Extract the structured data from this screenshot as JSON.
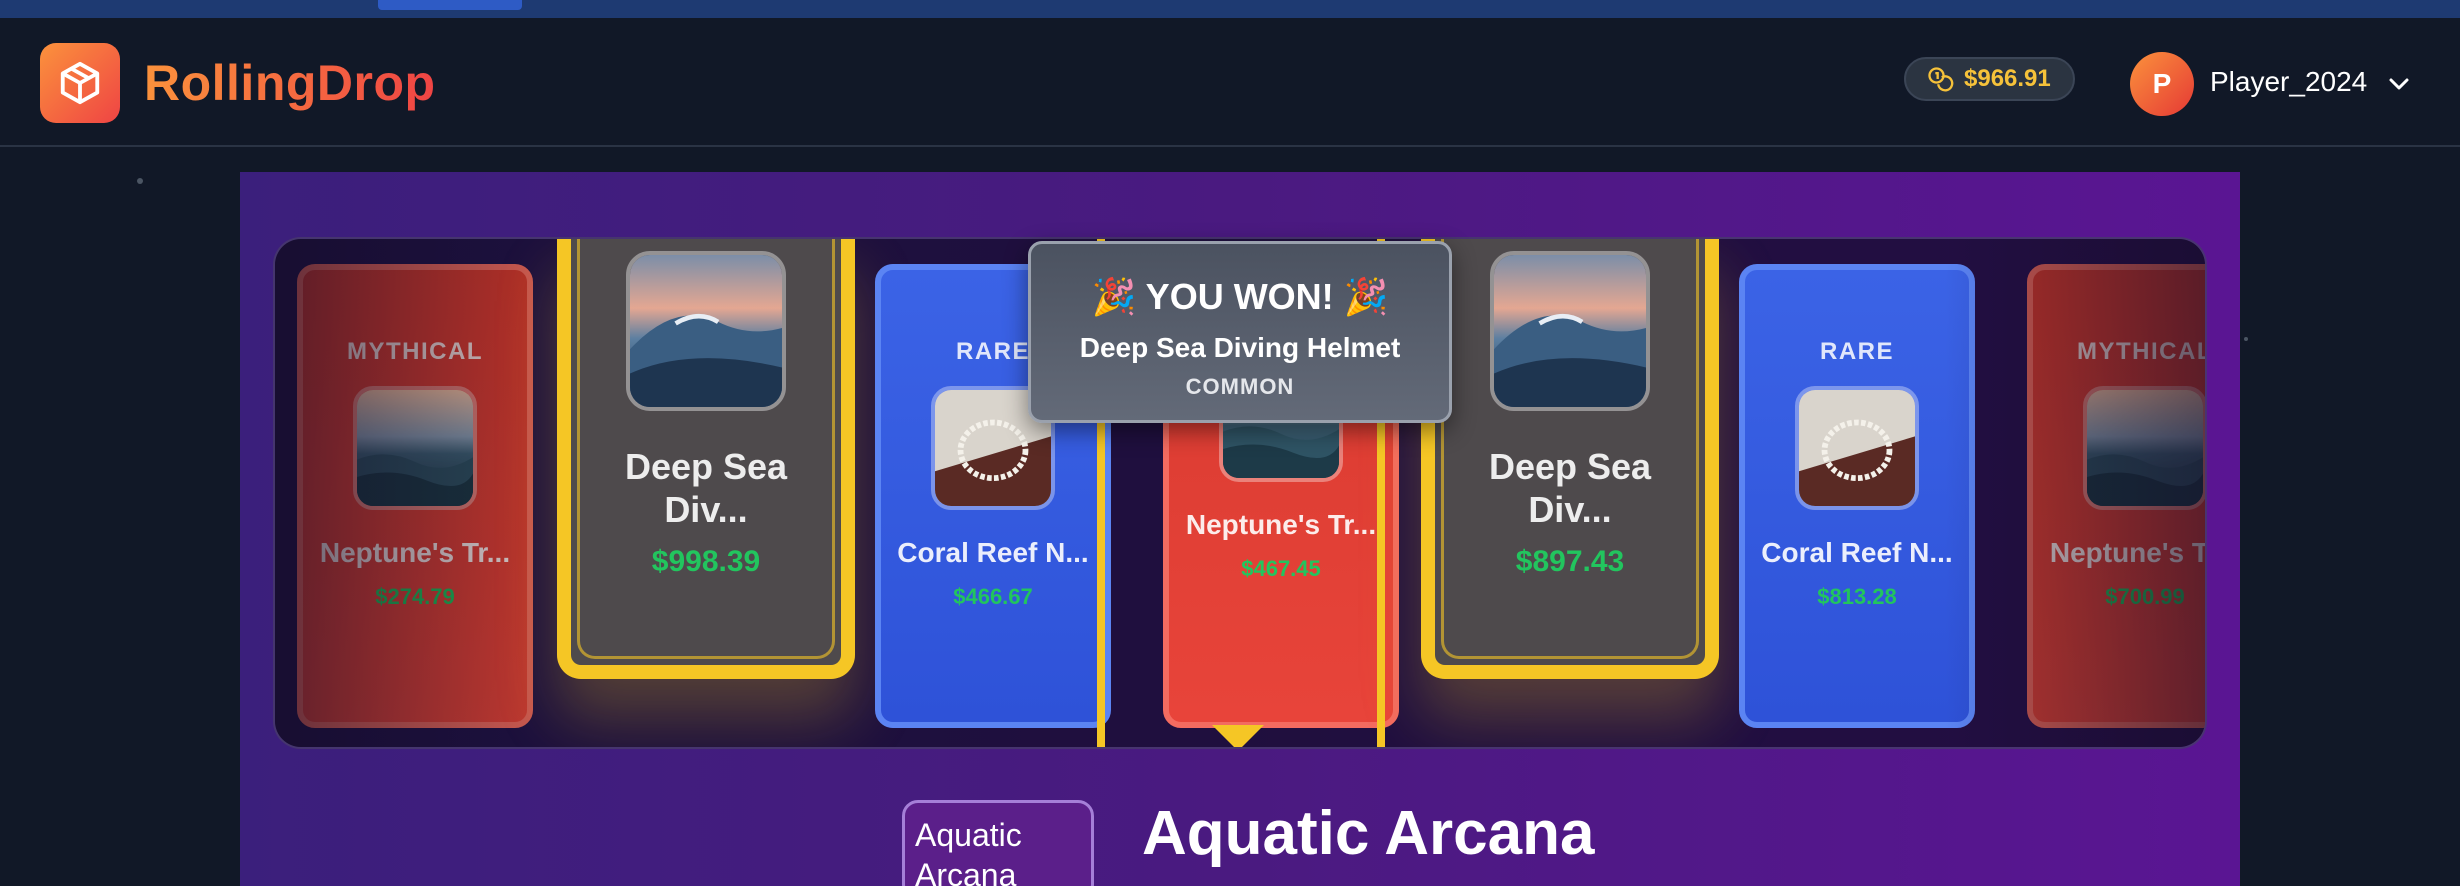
{
  "header": {
    "brand": "RollingDrop",
    "balance": "$966.91",
    "user_initial": "P",
    "username": "Player_2024"
  },
  "reel": {
    "cards": [
      {
        "rarity": "MYTHICAL",
        "name": "Neptune's Tr...",
        "price": "$274.79",
        "style": "red",
        "image": "ocean-sunset"
      },
      {
        "rarity": "",
        "name": "Deep Sea Div...",
        "price": "$998.39",
        "style": "brown",
        "image": "wave"
      },
      {
        "rarity": "RARE",
        "name": "Coral Reef N...",
        "price": "$466.67",
        "style": "blue",
        "image": "pearl-necklace"
      },
      {
        "rarity": "",
        "name": "Neptune's Tr...",
        "price": "$467.45",
        "style": "red",
        "image": "ocean-sunset"
      },
      {
        "rarity": "",
        "name": "Deep Sea Div...",
        "price": "$897.43",
        "style": "brown",
        "image": "wave"
      },
      {
        "rarity": "RARE",
        "name": "Coral Reef N...",
        "price": "$813.28",
        "style": "blue",
        "image": "pearl-necklace"
      },
      {
        "rarity": "MYTHICAL",
        "name": "Neptune's Tr...",
        "price": "$700.99",
        "style": "red",
        "image": "ocean-sunset"
      }
    ]
  },
  "result": {
    "title": "🎉 YOU WON! 🎉",
    "item": "Deep Sea Diving Helmet",
    "rarity": "COMMON"
  },
  "case": {
    "image_alt": "Aquatic Arcana",
    "title": "Aquatic Arcana"
  },
  "colors": {
    "accent": "#f97316",
    "gold": "#f5c625",
    "price_green": "#22c55e",
    "mythical_red": "#e03c33",
    "rare_blue": "#3458e0"
  }
}
